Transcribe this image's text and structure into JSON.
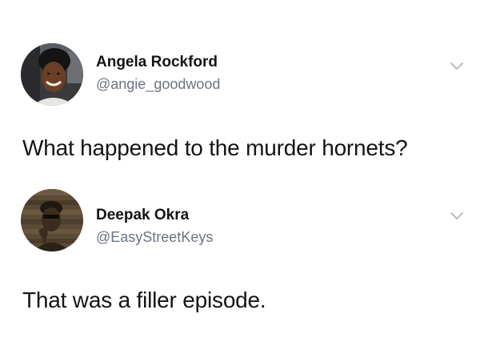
{
  "tweets": [
    {
      "display_name": "Angela Rockford",
      "handle": "@angie_goodwood",
      "text": "What happened to the murder hornets?",
      "avatar_icon": "profile-photo-woman-in-car",
      "menu_icon": "chevron-down-icon"
    },
    {
      "display_name": "Deepak Okra",
      "handle": "@EasyStreetKeys",
      "text": "That was a filler episode.",
      "avatar_icon": "profile-photo-man-sepia",
      "menu_icon": "chevron-down-icon"
    }
  ],
  "colors": {
    "text": "#141414",
    "secondary_text": "#6b7580",
    "chevron": "#b6bcc2",
    "background": "#ffffff"
  }
}
